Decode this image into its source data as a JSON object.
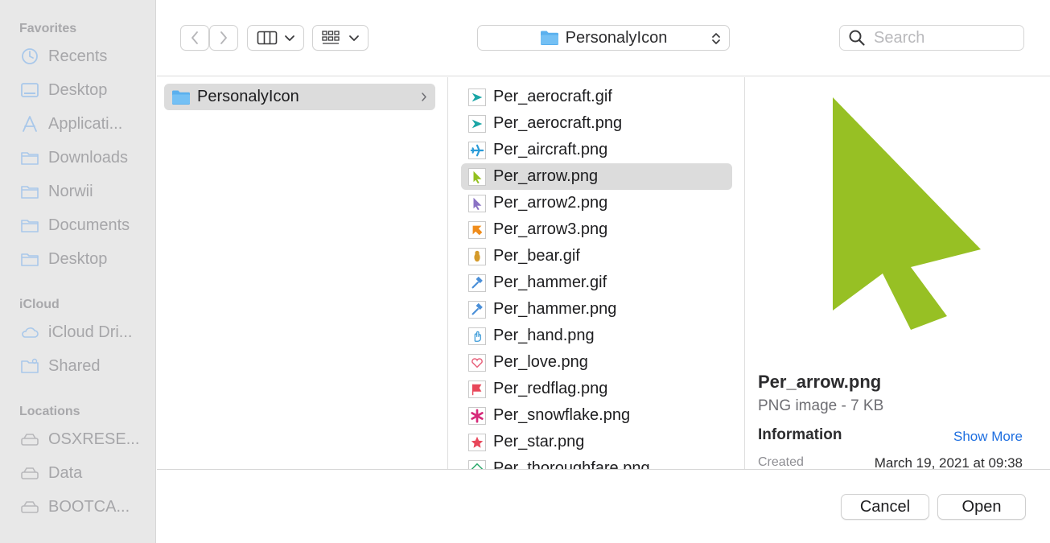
{
  "sidebar": {
    "sections": [
      {
        "title": "Favorites",
        "items": [
          {
            "label": "Recents",
            "icon": "clock-icon"
          },
          {
            "label": "Desktop",
            "icon": "desktop-icon"
          },
          {
            "label": "Applicati...",
            "icon": "applications-icon"
          },
          {
            "label": "Downloads",
            "icon": "folder-icon"
          },
          {
            "label": "Norwii",
            "icon": "folder-icon"
          },
          {
            "label": "Documents",
            "icon": "folder-icon"
          },
          {
            "label": "Desktop",
            "icon": "folder-icon"
          }
        ]
      },
      {
        "title": "iCloud",
        "items": [
          {
            "label": "iCloud Dri...",
            "icon": "cloud-icon"
          },
          {
            "label": "Shared",
            "icon": "shared-folder-icon"
          }
        ]
      },
      {
        "title": "Locations",
        "items": [
          {
            "label": "OSXRESE...",
            "icon": "drive-icon"
          },
          {
            "label": "Data",
            "icon": "drive-icon"
          },
          {
            "label": "BOOTCA...",
            "icon": "drive-icon"
          }
        ]
      }
    ]
  },
  "toolbar": {
    "current_folder": "PersonalyIcon",
    "search_placeholder": "Search"
  },
  "column1": {
    "folder": "PersonalyIcon"
  },
  "files": [
    {
      "name": "Per_aerocraft.gif",
      "icon": "aerocraft-icon",
      "color": "#1aa6a6"
    },
    {
      "name": "Per_aerocraft.png",
      "icon": "aerocraft-icon",
      "color": "#1aa6a6"
    },
    {
      "name": "Per_aircraft.png",
      "icon": "airplane-icon",
      "color": "#2a9bd8"
    },
    {
      "name": "Per_arrow.png",
      "icon": "arrow-cursor-icon",
      "color": "#93c01f",
      "selected": true
    },
    {
      "name": "Per_arrow2.png",
      "icon": "arrow-cursor-icon",
      "color": "#8a72c4"
    },
    {
      "name": "Per_arrow3.png",
      "icon": "arrow-diagonal-icon",
      "color": "#f08c1a"
    },
    {
      "name": "Per_bear.gif",
      "icon": "bear-icon",
      "color": "#d49a2a"
    },
    {
      "name": "Per_hammer.gif",
      "icon": "hammer-icon",
      "color": "#4a8fd8"
    },
    {
      "name": "Per_hammer.png",
      "icon": "hammer-icon",
      "color": "#4a8fd8"
    },
    {
      "name": "Per_hand.png",
      "icon": "hand-icon",
      "color": "#3a9ad8"
    },
    {
      "name": "Per_love.png",
      "icon": "heart-icon",
      "color": "#e8607a"
    },
    {
      "name": "Per_redflag.png",
      "icon": "flag-icon",
      "color": "#e8475a"
    },
    {
      "name": "Per_snowflake.png",
      "icon": "snowflake-icon",
      "color": "#d62a7a"
    },
    {
      "name": "Per_star.png",
      "icon": "star-icon",
      "color": "#e8475a"
    },
    {
      "name": "Per_thoroughfare.png",
      "icon": "thoroughfare-icon",
      "color": "#2aa86a"
    }
  ],
  "preview": {
    "name": "Per_arrow.png",
    "kind": "PNG image - 7 KB",
    "info_title": "Information",
    "show_more": "Show More",
    "created_label": "Created",
    "created_value": "March 19, 2021 at 09:38",
    "arrow_color": "#97c024"
  },
  "footer": {
    "cancel": "Cancel",
    "open": "Open"
  }
}
